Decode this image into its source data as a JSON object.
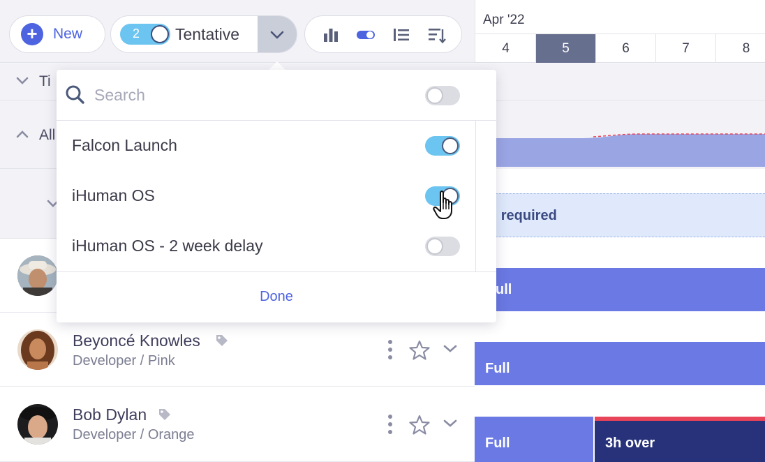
{
  "toolbar": {
    "new_label": "New",
    "tentative_count": "2",
    "tentative_label": "Tentative"
  },
  "timeline": {
    "month": "Apr '22",
    "days": [
      "4",
      "5",
      "6",
      "7",
      "8"
    ],
    "active_day": "5"
  },
  "sections": {
    "timeline_label": "Ti",
    "all_label": "All"
  },
  "people": [
    {
      "name": "Beyoncé Knowles",
      "role": "Developer / Pink"
    },
    {
      "name": "Bob Dylan",
      "role": "Developer / Orange"
    }
  ],
  "bars": {
    "required": "h required",
    "row1": "ull",
    "row2": "Full",
    "row3a": "Full",
    "row3b": "3h over"
  },
  "dropdown": {
    "search_placeholder": "Search",
    "items": [
      {
        "label": "Falcon Launch",
        "on": true
      },
      {
        "label": "iHuman OS",
        "on": true
      },
      {
        "label": "iHuman OS - 2 week delay",
        "on": false
      }
    ],
    "done_label": "Done"
  },
  "colors": {
    "accent": "#4d63e0",
    "toggle_on": "#6cc4f0",
    "bar_full": "#6a79e3",
    "bar_over": "#27327a",
    "over_line": "#e8445a"
  }
}
